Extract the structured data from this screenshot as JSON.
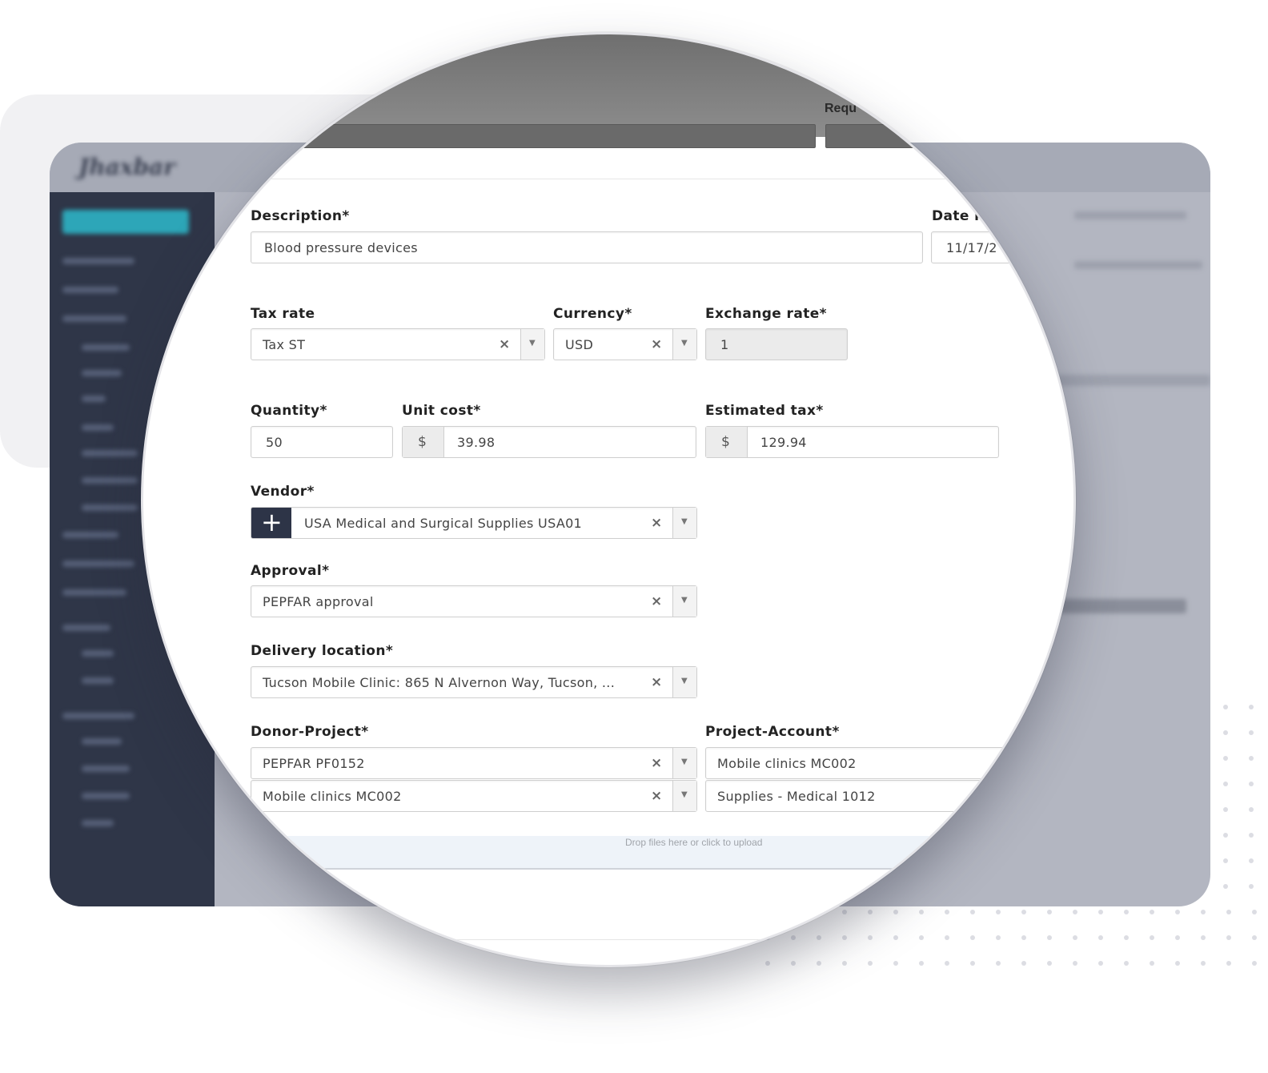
{
  "app": {
    "logo": "Jhaxbar"
  },
  "header": {
    "requested_label": "Requ"
  },
  "form": {
    "description": {
      "label": "Description*",
      "value": "Blood pressure devices"
    },
    "date": {
      "label": "Date r",
      "value": "11/17/2"
    },
    "tax_rate": {
      "label": "Tax rate",
      "value": "Tax ST"
    },
    "currency": {
      "label": "Currency*",
      "value": "USD"
    },
    "exchange_rate": {
      "label": "Exchange rate*",
      "value": "1"
    },
    "quantity": {
      "label": "Quantity*",
      "value": "50"
    },
    "unit_cost": {
      "label": "Unit cost*",
      "prefix": "$",
      "value": "39.98"
    },
    "estimated_tax": {
      "label": "Estimated tax*",
      "prefix": "$",
      "value": "129.94"
    },
    "vendor": {
      "label": "Vendor*",
      "value": "USA Medical and Surgical Supplies USA01",
      "add_icon": "plus-icon"
    },
    "approval": {
      "label": "Approval*",
      "value": "PEPFAR approval"
    },
    "delivery_location": {
      "label": "Delivery location*",
      "value": "Tucson Mobile Clinic: 865 N Alvernon Way, Tucson, ..."
    },
    "donor_project": {
      "label": "Donor-Project*",
      "values": [
        "PEPFAR PF0152",
        "Mobile clinics MC002"
      ]
    },
    "project_account": {
      "label": "Project-Account*",
      "values": [
        "Mobile clinics MC002",
        "Supplies - Medical 1012"
      ]
    },
    "upload": {
      "text": "Drop files here or click to upload"
    }
  },
  "icons": {
    "clear": "×",
    "dropdown": "▼",
    "plus": "+"
  },
  "colors": {
    "accent": "#2da6b8",
    "sidebar": "#2f3648",
    "plus_button": "#2d3447"
  }
}
